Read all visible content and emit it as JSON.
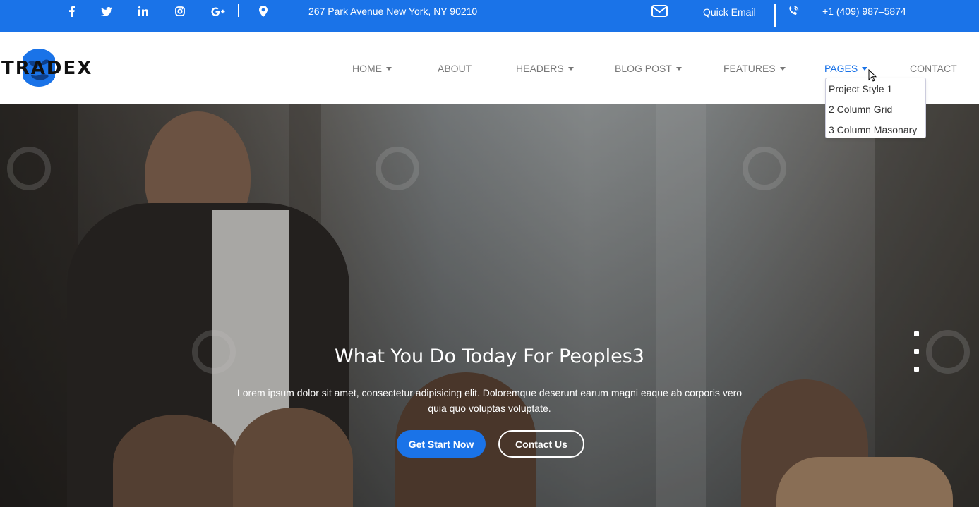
{
  "topbar": {
    "address": "267 Park Avenue New York, NY 90210",
    "email_label": "Quick Email",
    "phone": "+1 (409) 987–5874",
    "social_icons": [
      "facebook-icon",
      "twitter-icon",
      "linkedin-icon",
      "instagram-icon",
      "google-plus-icon"
    ],
    "bg_color": "#1a73e8"
  },
  "logo": {
    "text": "TRADEX"
  },
  "nav": {
    "items": [
      {
        "label": "HOME",
        "has_dropdown": true
      },
      {
        "label": "ABOUT",
        "has_dropdown": false
      },
      {
        "label": "HEADERS",
        "has_dropdown": true
      },
      {
        "label": "BLOG POST",
        "has_dropdown": true
      },
      {
        "label": "FEATURES",
        "has_dropdown": true
      },
      {
        "label": "PAGES",
        "has_dropdown": true,
        "active": true
      },
      {
        "label": "CONTACT",
        "has_dropdown": false
      }
    ],
    "pages_dropdown": [
      "Project Style 1",
      "2 Column Grid",
      "3 Column Masonary"
    ],
    "accent_color": "#1a73e8"
  },
  "hero": {
    "title": "What You Do Today For Peoples3",
    "subtitle": "Lorem ipsum dolor sit amet, consectetur adipisicing elit. Doloremque deserunt earum magni eaque ab corporis vero quia quo voluptas voluptate.",
    "primary_button": "Get Start Now",
    "secondary_button": "Contact Us"
  }
}
